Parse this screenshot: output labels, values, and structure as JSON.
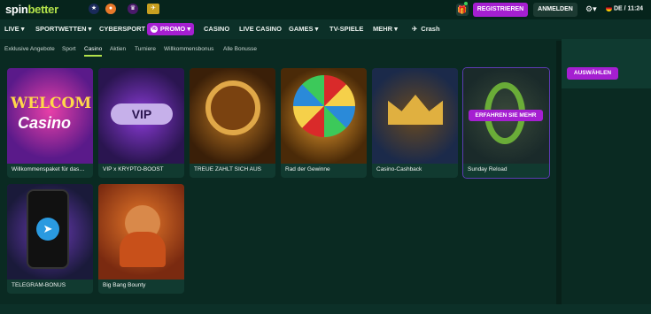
{
  "header": {
    "logo_main": "spin",
    "logo_accent": "better",
    "register_label": "REGISTRIEREN",
    "login_label": "ANMELDEN",
    "lang_time": "DE / 11:24",
    "partners": [
      "uefa-champions-league-icon",
      "uefa-europa-league-icon",
      "premier-league-icon",
      "crash-badge-icon"
    ]
  },
  "nav": {
    "items": [
      {
        "label": "LIVE ▾"
      },
      {
        "label": "SPORTWETTEN ▾"
      },
      {
        "label": "CYBERSPORT"
      },
      {
        "label": "PROMO ▾"
      },
      {
        "label": "CASINO"
      },
      {
        "label": "LIVE CASINO"
      },
      {
        "label": "GAMES ▾"
      },
      {
        "label": "TV-SPIELE"
      },
      {
        "label": "MEHR ▾"
      },
      {
        "label": "Crash"
      }
    ]
  },
  "subnav": {
    "items": [
      {
        "label": "Exklusive Angebote"
      },
      {
        "label": "Sport"
      },
      {
        "label": "Casino"
      },
      {
        "label": "Aktien"
      },
      {
        "label": "Turniere"
      },
      {
        "label": "Willkommensbonus"
      },
      {
        "label": "Alle Bonusse"
      }
    ],
    "active": "Casino"
  },
  "cards": [
    {
      "label": "Willkommenspaket für das…",
      "colors": [
        "#5a1a8a",
        "#e83fa8"
      ]
    },
    {
      "label": "VIP x KRYPTO-BOOST",
      "colors": [
        "#2a1550",
        "#8a3ad6"
      ]
    },
    {
      "label": "TREUE ZAHLT SICH AUS",
      "colors": [
        "#3a1f08",
        "#c07a24"
      ]
    },
    {
      "label": "Rad der Gewinne",
      "colors": [
        "#4a2a08",
        "#e69a2e"
      ]
    },
    {
      "label": "Casino-Cashback",
      "colors": [
        "#1b2a4a",
        "#d8a936"
      ]
    },
    {
      "label": "Sunday Reload",
      "colors": [
        "#1a2a2a",
        "#5a7a3a"
      ]
    },
    {
      "label": "TELEGRAM-BONUS",
      "colors": [
        "#1a1a3a",
        "#6a3ab6"
      ]
    },
    {
      "label": "Big Bang Bounty",
      "colors": [
        "#7a2a10",
        "#e6782a"
      ]
    }
  ],
  "hover_button": "ERFAHREN SIE MEHR",
  "side_panel": {
    "button": "AUSWÄHLEN"
  }
}
